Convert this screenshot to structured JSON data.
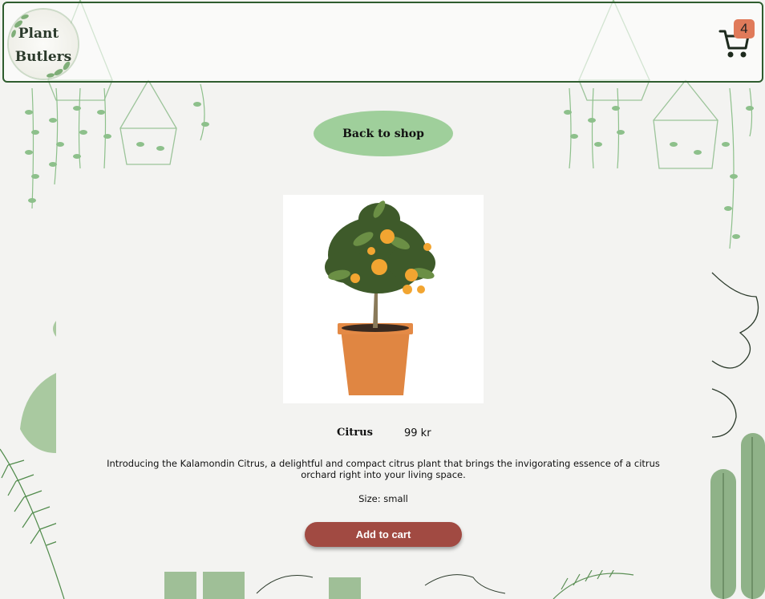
{
  "header": {
    "logo_line1": "Plant",
    "logo_line2": "Butlers",
    "cart_count": "4"
  },
  "nav": {
    "back_label": "Back to shop"
  },
  "product": {
    "name": "Citrus",
    "price": "99 kr",
    "description": "Introducing the Kalamondin Citrus, a delightful and compact citrus plant that brings the invigorating essence of a citrus orchard right into your living space.",
    "size_label": "Size: small",
    "add_to_cart_label": "Add to cart"
  },
  "colors": {
    "accent_green": "#9fcf9b",
    "cart_button": "#a14a42",
    "badge": "#e07a5a",
    "header_border": "#2f5d2f"
  }
}
